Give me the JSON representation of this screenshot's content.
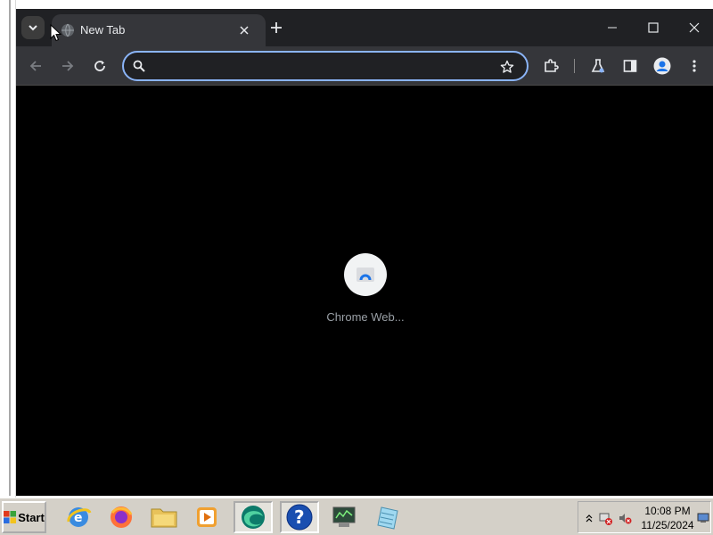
{
  "browser": {
    "tab": {
      "title": "New Tab"
    },
    "omnibox": {
      "value": "",
      "placeholder": ""
    },
    "content": {
      "loading_label": "Chrome Web..."
    }
  },
  "taskbar": {
    "start_label": "Start",
    "apps": [
      "internet-explorer",
      "firefox",
      "file-explorer",
      "media-player",
      "edge-browser",
      "help",
      "system-monitor",
      "notepad"
    ],
    "tray": {
      "time": "10:08 PM",
      "date": "11/25/2024"
    }
  },
  "colors": {
    "tabstrip": "#202124",
    "toolbar": "#35363a",
    "accent": "#8ab4f8",
    "page_bg": "#000000",
    "taskbar": "#d4d0c8"
  }
}
